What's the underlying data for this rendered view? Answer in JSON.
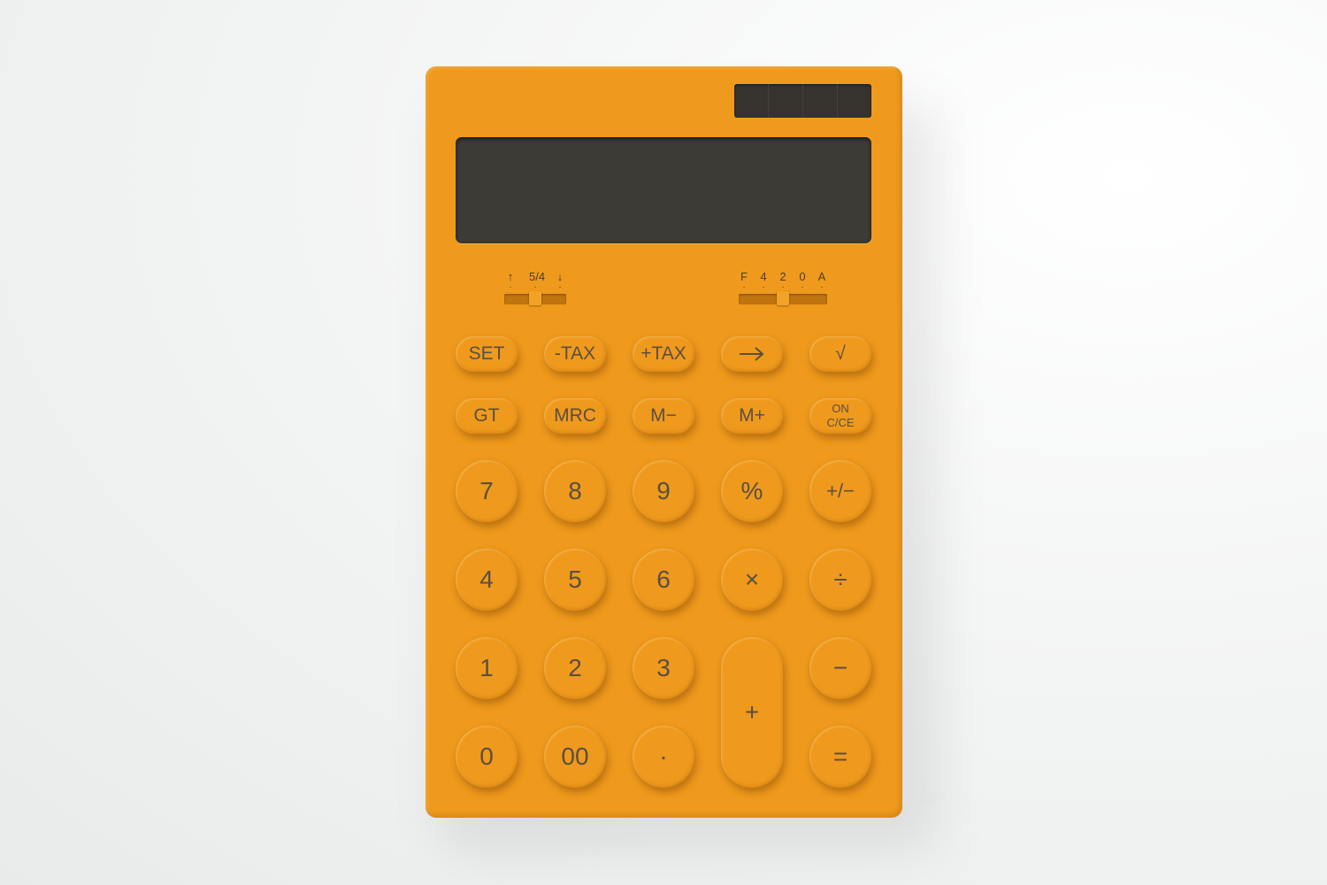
{
  "switches": {
    "rounding": {
      "labels": [
        "↑",
        "5/4",
        "↓"
      ],
      "selected": "5/4"
    },
    "decimal": {
      "labels": [
        "F",
        "4",
        "2",
        "0",
        "A"
      ],
      "selected": "2"
    }
  },
  "function_keys": [
    "SET",
    "-TAX",
    "+TAX",
    "→",
    "√"
  ],
  "memory_keys": [
    "GT",
    "MRC",
    "M−",
    "M+"
  ],
  "on_key": {
    "line1": "ON",
    "line2": "C/CE"
  },
  "keys": {
    "seven": "7",
    "eight": "8",
    "nine": "9",
    "percent": "%",
    "sign": "+/−",
    "four": "4",
    "five": "5",
    "six": "6",
    "multiply": "×",
    "plus": "+",
    "one": "1",
    "two": "2",
    "three": "3",
    "divide": "÷",
    "minus": "−",
    "zero": "0",
    "double_zero": "00",
    "decimal": "·",
    "equals": "="
  },
  "colors": {
    "body": "#ef9a1c",
    "display": "#3c3b36",
    "text": "#5b4e42"
  }
}
